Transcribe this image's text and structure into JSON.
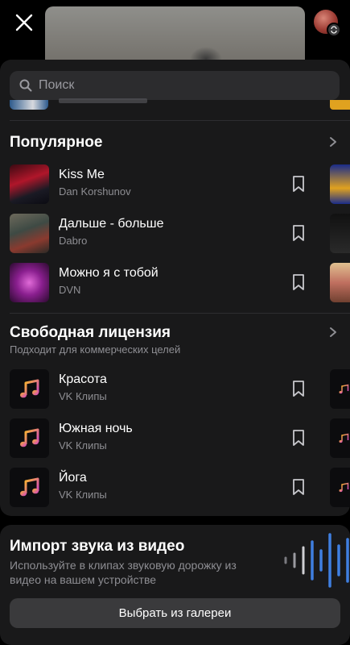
{
  "search": {
    "placeholder": "Поиск"
  },
  "popular": {
    "title": "Популярное",
    "tracks": [
      {
        "title": "Kiss Me",
        "artist": "Dan Korshunov"
      },
      {
        "title": "Дальше - больше",
        "artist": "Dabro"
      },
      {
        "title": "Можно я с тобой",
        "artist": "DVN"
      }
    ]
  },
  "free_license": {
    "title": "Свободная лицензия",
    "subtitle": "Подходит для коммерческих целей",
    "tracks": [
      {
        "title": "Красота",
        "artist": "VK Клипы"
      },
      {
        "title": "Южная ночь",
        "artist": "VK Клипы"
      },
      {
        "title": "Йога",
        "artist": "VK Клипы"
      }
    ]
  },
  "import": {
    "title": "Импорт звука из видео",
    "description": "Используйте в клипах звуковую дорожку из видео на вашем устройстве",
    "button_label": "Выбрать из галереи"
  },
  "colors": {
    "accent_note_from": "#f7b52b",
    "accent_note_to": "#d13dcf",
    "wave": "#3f7fe0"
  }
}
